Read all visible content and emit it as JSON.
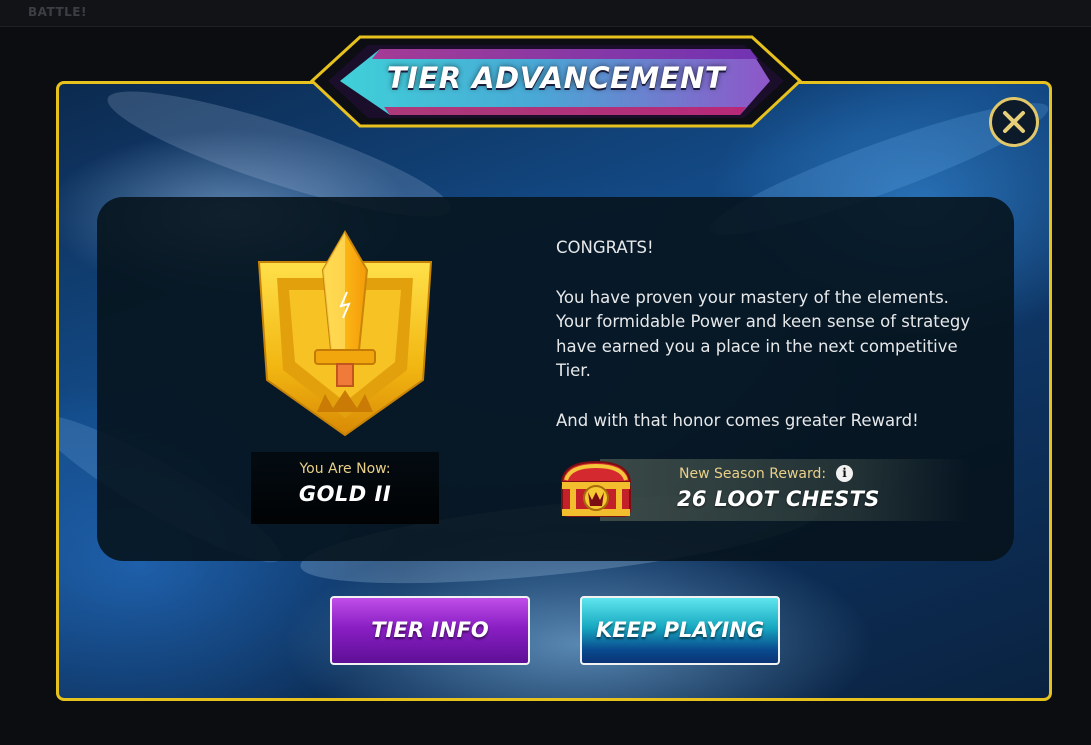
{
  "background": {
    "nav_label": "BATTLE!"
  },
  "dialog": {
    "title": "TIER ADVANCEMENT",
    "close_icon": "close-x-icon"
  },
  "rank": {
    "badge_icon": "gold-tier-sword-shield-icon",
    "label": "You Are Now:",
    "value": "GOLD II"
  },
  "message": {
    "heading": "CONGRATS!",
    "body": "You have proven your mastery of the elements. Your formidable Power and keen sense of strategy have earned you a place in the next competitive Tier.",
    "closing": "And with that honor comes greater Reward!"
  },
  "reward": {
    "chest_icon": "loot-chest-icon",
    "label": "New Season Reward:",
    "info_icon": "info-icon",
    "value": "26 LOOT CHESTS"
  },
  "buttons": {
    "tier_info": "TIER INFO",
    "keep_playing": "KEEP PLAYING"
  },
  "colors": {
    "frame": "#e7c21f",
    "gold": "#f2c01e",
    "tier_info_button": "#8a1fc4",
    "keep_playing_button": "#17a9c1"
  }
}
